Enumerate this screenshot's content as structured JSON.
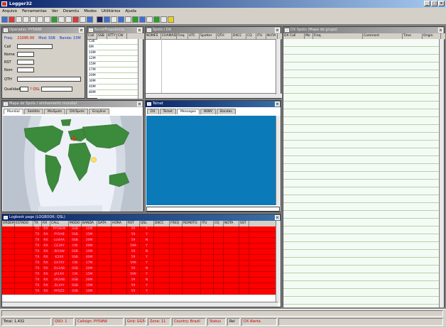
{
  "app": {
    "title": "Logger32"
  },
  "menu": [
    "Arquivo",
    "Ferramentas",
    "Ver",
    "Dowmlu",
    "Modos",
    "Utilitários",
    "Ajuda"
  ],
  "callsign_panel": {
    "title": "Operador: PY5WW",
    "freq_label": "Freq:",
    "freq_value": "21095.00",
    "mode_value": "Mod: SSB",
    "band_value": "Banda: 15M",
    "labels": [
      "Call",
      "Nome",
      "RST",
      "Nom",
      "QTH",
      "Qualidade"
    ],
    "qsl_label": "? QSL"
  },
  "bandmap_panel": {
    "title": "Band/Frequência",
    "columns": [
      "Call",
      "SSB",
      "RTTY",
      "CW"
    ],
    "items": [
      "Call",
      "6M",
      "10M",
      "12M",
      "15M",
      "17M",
      "20M",
      "30M",
      "40M",
      "80M",
      "160M"
    ]
  },
  "dx_panel": {
    "title": "Spots / DX",
    "columns": [
      "NOMES",
      "CHAMADA",
      "Freq",
      "UTC",
      "Spotter",
      "QTH",
      "DXCC",
      "CQ",
      "ITU",
      "NOTA"
    ]
  },
  "dx_spots_panel": {
    "title": "DX Spots (Mapa de grupo)",
    "columns": [
      "DX Call",
      "Mo",
      "Freq",
      "Comment",
      "Time",
      "Origin"
    ]
  },
  "map_panel": {
    "title": "Mapa de Spots / alinhamento mundial",
    "tabs": [
      "Mundial",
      "Satélite",
      "MixSpots",
      "DX/Spots",
      "Grayline"
    ],
    "active_tab": 0
  },
  "telnet_panel": {
    "title": "Telnet",
    "tabs": [
      "DX",
      "Telnet",
      "Messages",
      "WWV",
      "Bandas"
    ],
    "active_tab": 2
  },
  "logbook_panel": {
    "title": "Logbook page (LOGBOOK: QSL)",
    "columns": [
      "ORDEM",
      "ESTADO",
      "TX",
      "RX",
      "CALL",
      "MODO",
      "BANDA",
      "DATA",
      "HORA",
      "RST",
      "QSL",
      "DXCC",
      "FREQ",
      "REMOTO",
      "ITU",
      "CQ",
      "NOTA",
      "SST"
    ],
    "rows": [
      [
        "",
        "",
        "TX",
        "RX",
        "PY5WW",
        "SSB",
        "15M",
        "",
        "",
        "59",
        "Y",
        "",
        "",
        "",
        "",
        "",
        "",
        ""
      ],
      [
        "",
        "",
        "TX",
        "RX",
        "PY5AB",
        "SSB",
        "15M",
        "",
        "",
        "59",
        "Y",
        "",
        "",
        "",
        "",
        "",
        "",
        ""
      ],
      [
        "",
        "",
        "TX",
        "RX",
        "LU4AA",
        "SSB",
        "20M",
        "",
        "",
        "59",
        "N",
        "",
        "",
        "",
        "",
        "",
        "",
        ""
      ],
      [
        "",
        "",
        "TX",
        "RX",
        "CE3XY",
        "CW",
        "20M",
        "",
        "",
        "599",
        "Y",
        "",
        "",
        "",
        "",
        "",
        "",
        ""
      ],
      [
        "",
        "",
        "TX",
        "RX",
        "W1AW",
        "SSB",
        "15M",
        "",
        "",
        "59",
        "N",
        "",
        "",
        "",
        "",
        "",
        "",
        ""
      ],
      [
        "",
        "",
        "TX",
        "RX",
        "K2XX",
        "SSB",
        "40M",
        "",
        "",
        "59",
        "Y",
        "",
        "",
        "",
        "",
        "",
        "",
        ""
      ],
      [
        "",
        "",
        "TX",
        "RX",
        "EA7XY",
        "CW",
        "17M",
        "",
        "",
        "599",
        "Y",
        "",
        "",
        "",
        "",
        "",
        "",
        ""
      ],
      [
        "",
        "",
        "TX",
        "RX",
        "DL1AB",
        "SSB",
        "20M",
        "",
        "",
        "59",
        "N",
        "",
        "",
        "",
        "",
        "",
        "",
        ""
      ],
      [
        "",
        "",
        "TX",
        "RX",
        "JA1XX",
        "CW",
        "15M",
        "",
        "",
        "599",
        "Y",
        "",
        "",
        "",
        "",
        "",
        "",
        ""
      ],
      [
        "",
        "",
        "TX",
        "RX",
        "VK2AB",
        "SSB",
        "20M",
        "",
        "",
        "59",
        "N",
        "",
        "",
        "",
        "",
        "",
        "",
        ""
      ],
      [
        "",
        "",
        "TX",
        "RX",
        "ZL1XY",
        "SSB",
        "15M",
        "",
        "",
        "59",
        "Y",
        "",
        "",
        "",
        "",
        "",
        "",
        ""
      ],
      [
        "",
        "",
        "TX",
        "RX",
        "PP5ZZ",
        "SSB",
        "10M",
        "",
        "",
        "59",
        "Y",
        "",
        "",
        "",
        "",
        "",
        "",
        ""
      ]
    ]
  },
  "status": {
    "segments": [
      "Total: 1,432",
      "QSO: 1",
      "Callsign: PY5WW",
      "Grid: GG54",
      "Zone: 11",
      "Country: Brazil",
      "Status",
      "Rel",
      "DX Alerta"
    ]
  },
  "colors": {
    "logbook_row": "#ff0000",
    "telnet_bg": "#0a7ab8"
  }
}
